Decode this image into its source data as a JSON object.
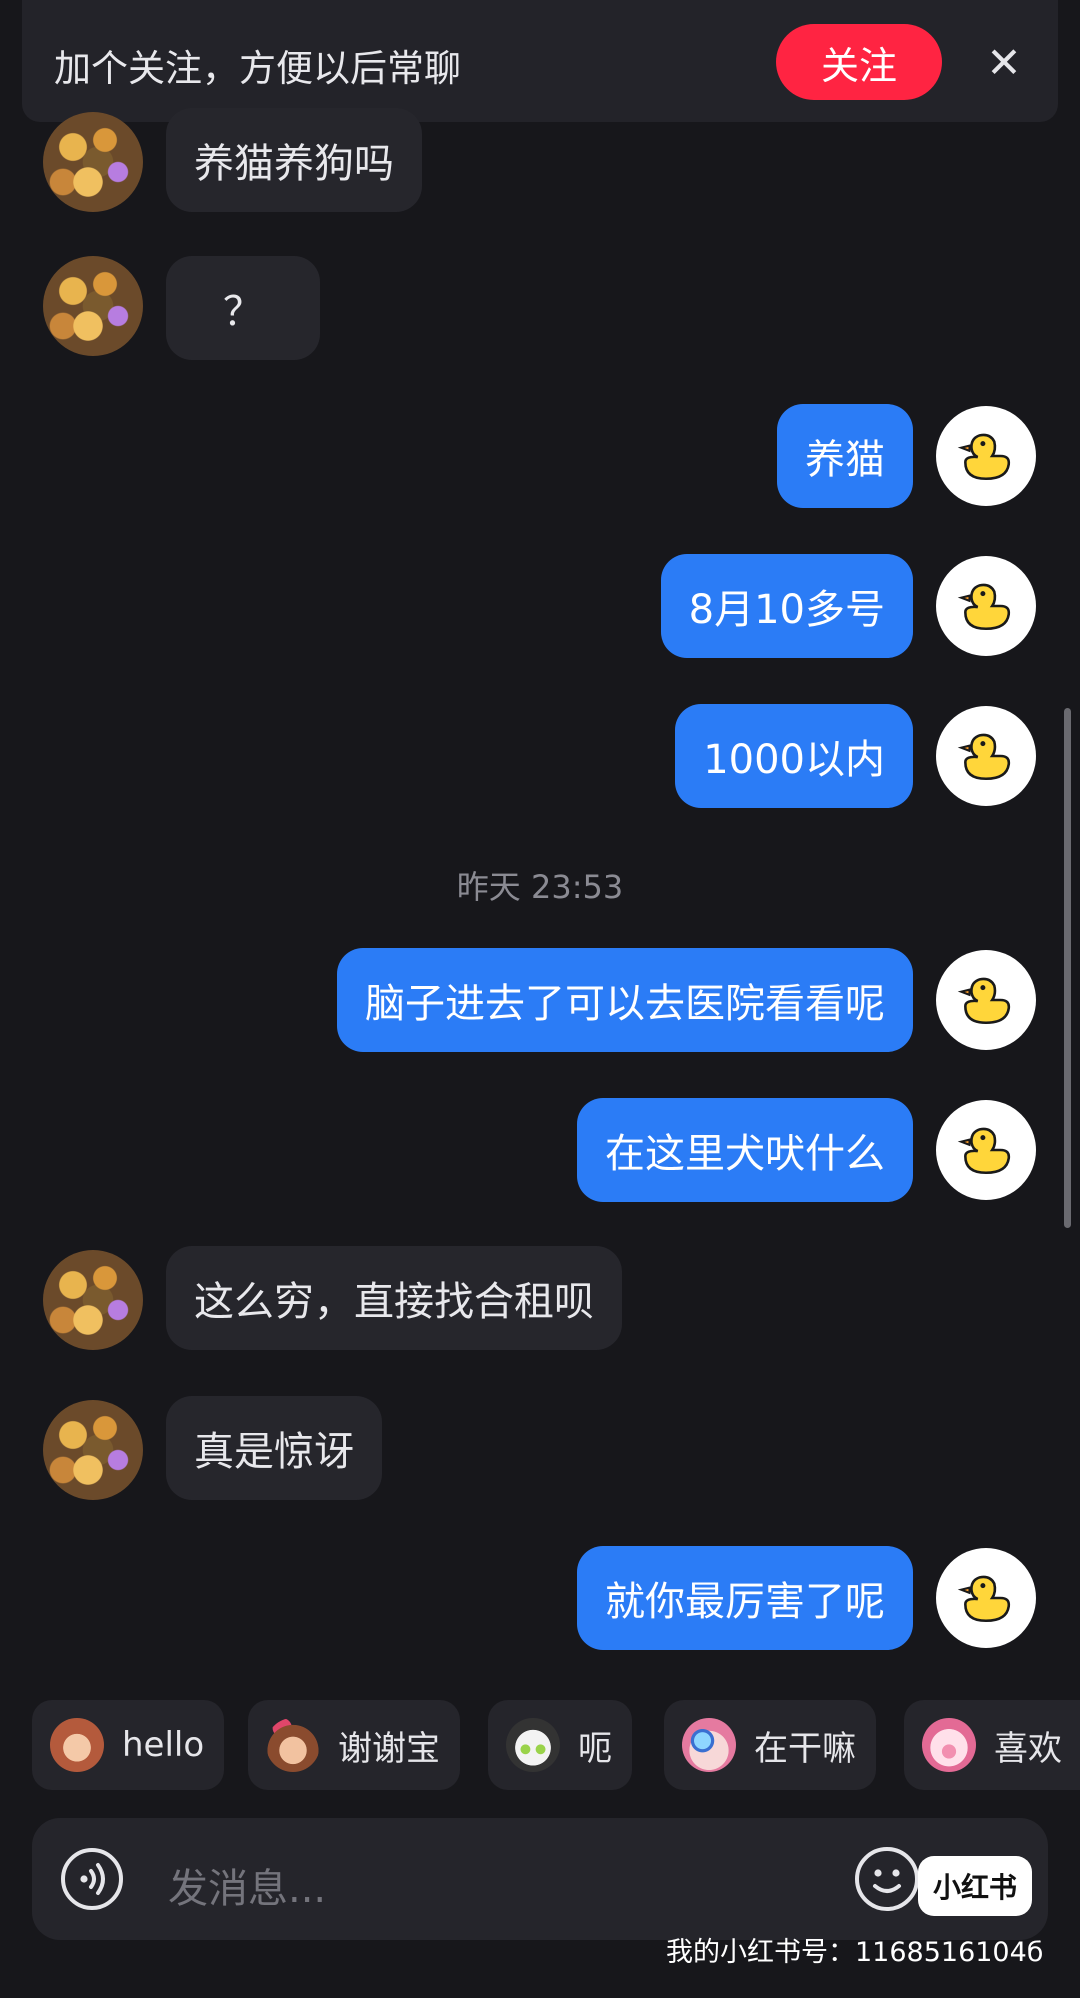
{
  "banner": {
    "text": "加个关注，方便以后常聊",
    "follow_label": "关注",
    "close_glyph": "✕",
    "accent_color": "#ff2442"
  },
  "messages": [
    {
      "side": "other",
      "text": "养猫养狗吗"
    },
    {
      "side": "other",
      "text": "？"
    },
    {
      "side": "me",
      "text": "养猫"
    },
    {
      "side": "me",
      "text": "8月10多号"
    },
    {
      "side": "me",
      "text": "1000以内"
    },
    {
      "side": "me",
      "text": "脑子进去了可以去医院看看呢"
    },
    {
      "side": "me",
      "text": "在这里犬吠什么"
    },
    {
      "side": "other",
      "text": "这么穷，直接找合租呗"
    },
    {
      "side": "other",
      "text": "真是惊讶"
    },
    {
      "side": "me",
      "text": "就你最厉害了呢"
    }
  ],
  "timestamp": "昨天 23:53",
  "quick_replies": [
    {
      "label": "hello",
      "icon": "monkey-icon"
    },
    {
      "label": "谢谢宝",
      "icon": "flower-girl-icon"
    },
    {
      "label": "呃",
      "icon": "cat-icon"
    },
    {
      "label": "在干嘛",
      "icon": "magnifier-icon"
    },
    {
      "label": "喜欢",
      "icon": "pig-icon"
    }
  ],
  "input": {
    "placeholder": "发消息..."
  },
  "watermark": {
    "logo_text": "小红书",
    "id_text": "我的小红书号：1168516104б"
  },
  "colors": {
    "background": "#17171b",
    "my_bubble": "#2b7cf6",
    "other_bubble": "#26262c"
  }
}
